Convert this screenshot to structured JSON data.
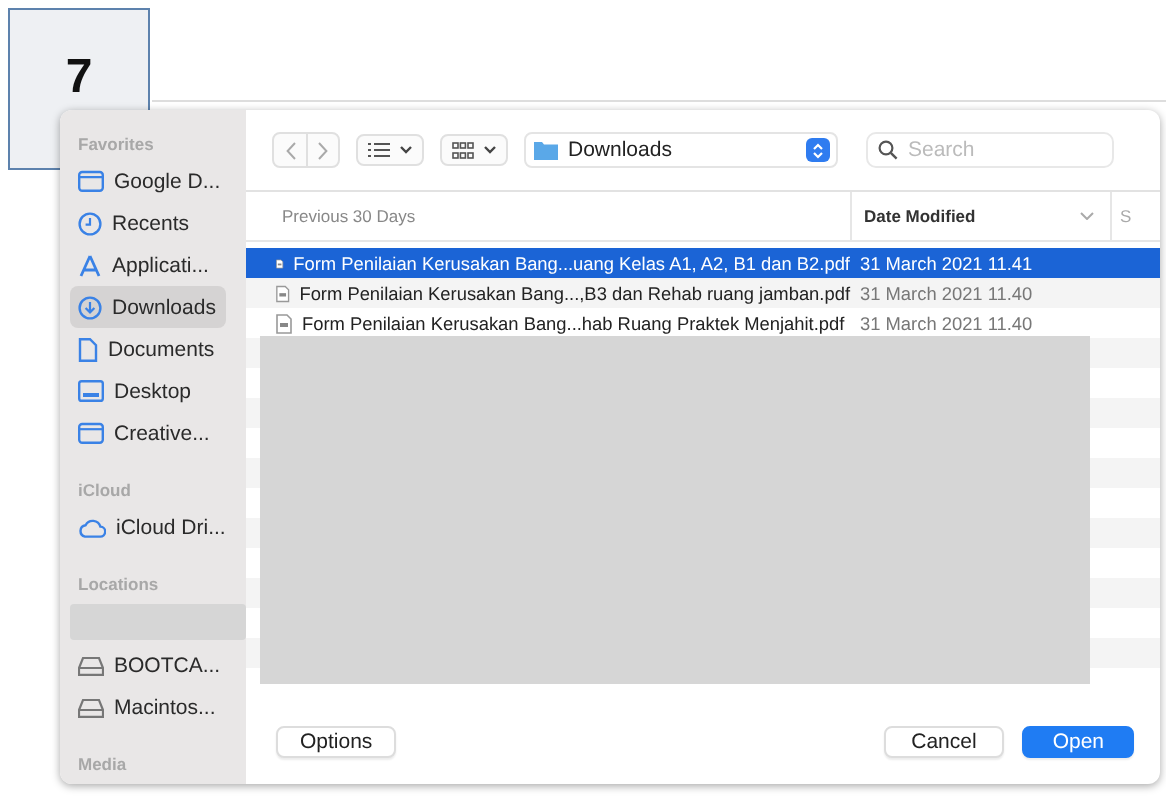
{
  "step_badge": {
    "label": "7"
  },
  "sidebar": {
    "sections": [
      {
        "heading": "Favorites",
        "items": [
          {
            "label": "Google D...",
            "kind": "folder",
            "selected": false
          },
          {
            "label": "Recents",
            "kind": "clock",
            "selected": false
          },
          {
            "label": "Applicati...",
            "kind": "apps",
            "selected": false
          },
          {
            "label": "Downloads",
            "kind": "download",
            "selected": true
          },
          {
            "label": "Documents",
            "kind": "document",
            "selected": false
          },
          {
            "label": "Desktop",
            "kind": "desktop",
            "selected": false
          },
          {
            "label": "Creative...",
            "kind": "folder",
            "selected": false
          }
        ]
      },
      {
        "heading": "iCloud",
        "items": [
          {
            "label": "iCloud Dri...",
            "kind": "cloud",
            "selected": false
          }
        ]
      },
      {
        "heading": "Locations",
        "items": [
          {
            "kind": "redacted"
          },
          {
            "label": "BOOTCA...",
            "kind": "drive",
            "selected": false
          },
          {
            "label": "Macintos...",
            "kind": "drive",
            "selected": false
          }
        ]
      },
      {
        "heading": "Media"
      }
    ]
  },
  "toolbar": {
    "location": "Downloads",
    "search": {
      "placeholder": "Search"
    }
  },
  "table": {
    "columns": [
      "Previous 30 Days",
      "Date Modified",
      "S"
    ],
    "rows": [
      {
        "name": "Form Penilaian Kerusakan Bang...uang Kelas A1, A2, B1 dan B2.pdf",
        "date": "31 March 2021 11.41",
        "selected": true
      },
      {
        "name": "Form Penilaian Kerusakan Bang...,B3 dan Rehab ruang jamban.pdf",
        "date": "31 March 2021 11.40",
        "selected": false
      },
      {
        "name": "Form Penilaian Kerusakan Bang...hab Ruang Praktek Menjahit.pdf",
        "date": "31 March 2021 11.40",
        "selected": false
      }
    ]
  },
  "buttons": {
    "options": "Options",
    "cancel": "Cancel",
    "open": "Open"
  }
}
